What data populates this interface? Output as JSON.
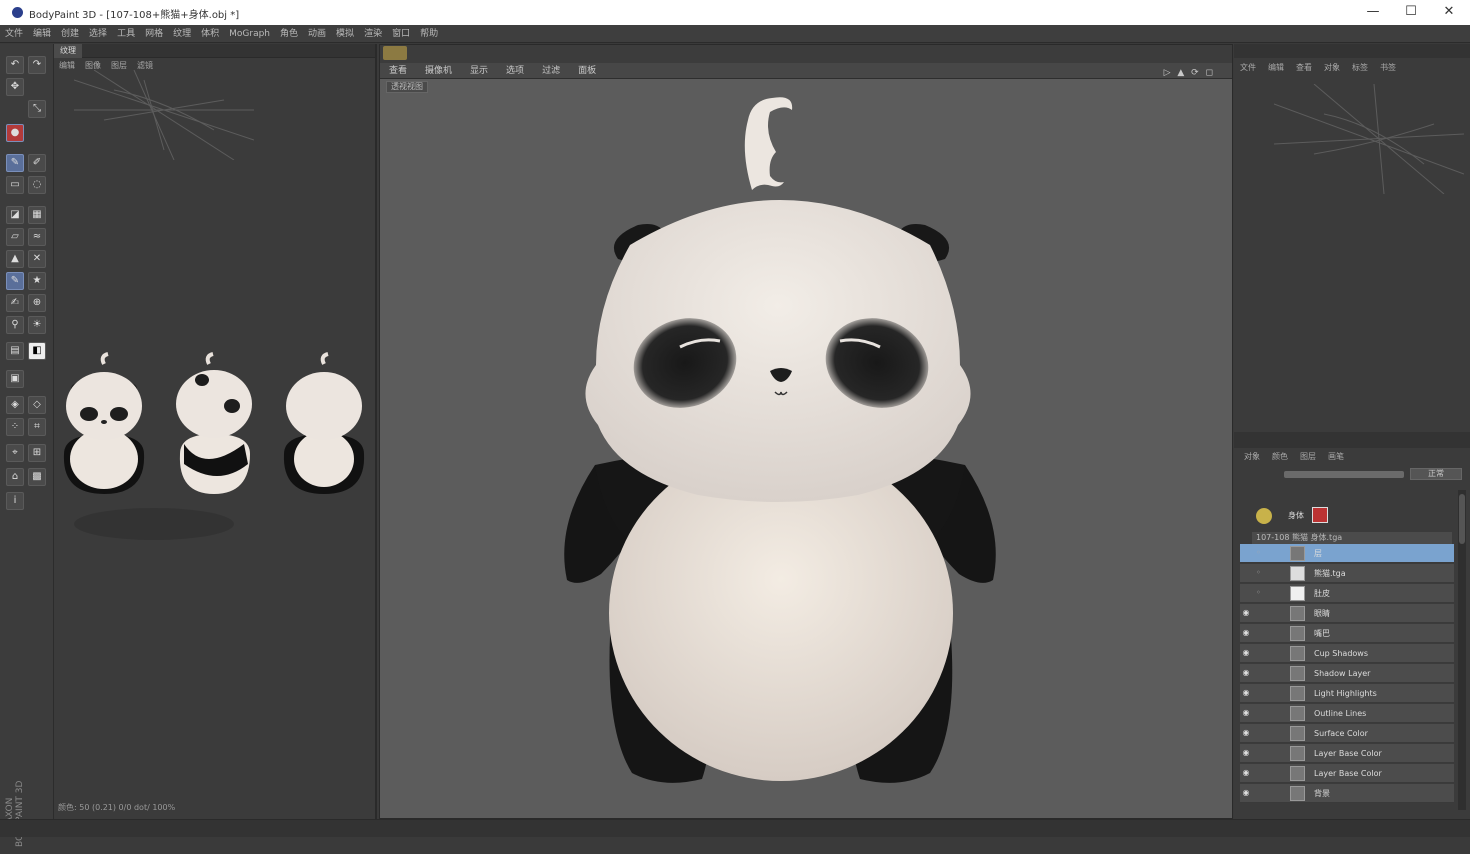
{
  "window": {
    "title": "BodyPaint 3D - [107-108+熊猫+身体.obj *]",
    "minimize": "—",
    "maximize": "☐",
    "close": "✕"
  },
  "menu": [
    "文件",
    "编辑",
    "创建",
    "选择",
    "工具",
    "网格",
    "纹理",
    "体积",
    "MoGraph",
    "角色",
    "动画",
    "模拟",
    "渲染",
    "窗口",
    "帮助"
  ],
  "toolbar": {
    "brand": "MAXON BODYPAINT 3D"
  },
  "left_panel": {
    "tab": "纹理",
    "sub_menu": [
      "编辑",
      "图像",
      "图层",
      "滤镜"
    ],
    "status": "颜色: 50 (0.21) 0/0 dot/ 100%"
  },
  "viewport": {
    "menu": [
      "查看",
      "摄像机",
      "显示",
      "选项",
      "过滤",
      "面板"
    ],
    "label": "透视视图",
    "view_icons": "▷ ▲ ⟳ ◻"
  },
  "right_panel": {
    "tabs": [
      "文件",
      "编辑",
      "查看",
      "对象",
      "标签",
      "书签"
    ],
    "layers_tabs": [
      "对象",
      "颜色",
      "图层",
      "画笔"
    ],
    "blend_mode": "正常",
    "object_name": "身体",
    "material_tag": "107-108 熊猫 身体.tga",
    "layers": [
      {
        "name": "层",
        "selected": true,
        "visible": false
      },
      {
        "name": "熊猫.tga",
        "selected": false,
        "visible": false
      },
      {
        "name": "肚皮",
        "selected": false,
        "visible": false
      },
      {
        "name": "眼睛",
        "selected": false,
        "visible": true
      },
      {
        "name": "嘴巴",
        "selected": false,
        "visible": true
      },
      {
        "name": "Cup Shadows",
        "selected": false,
        "visible": true
      },
      {
        "name": "Shadow Layer",
        "selected": false,
        "visible": true
      },
      {
        "name": "Light Highlights",
        "selected": false,
        "visible": true
      },
      {
        "name": "Outline Lines",
        "selected": false,
        "visible": true
      },
      {
        "name": "Surface Color",
        "selected": false,
        "visible": true
      },
      {
        "name": "Layer Base Color",
        "selected": false,
        "visible": true
      },
      {
        "name": "Layer Base Color",
        "selected": false,
        "visible": true
      },
      {
        "name": "背景",
        "selected": false,
        "visible": true
      }
    ]
  },
  "colors": {
    "viewport_bg": "#5c5c5c",
    "panel_bg": "#3b3b3b",
    "selection": "#7aa3cf"
  }
}
